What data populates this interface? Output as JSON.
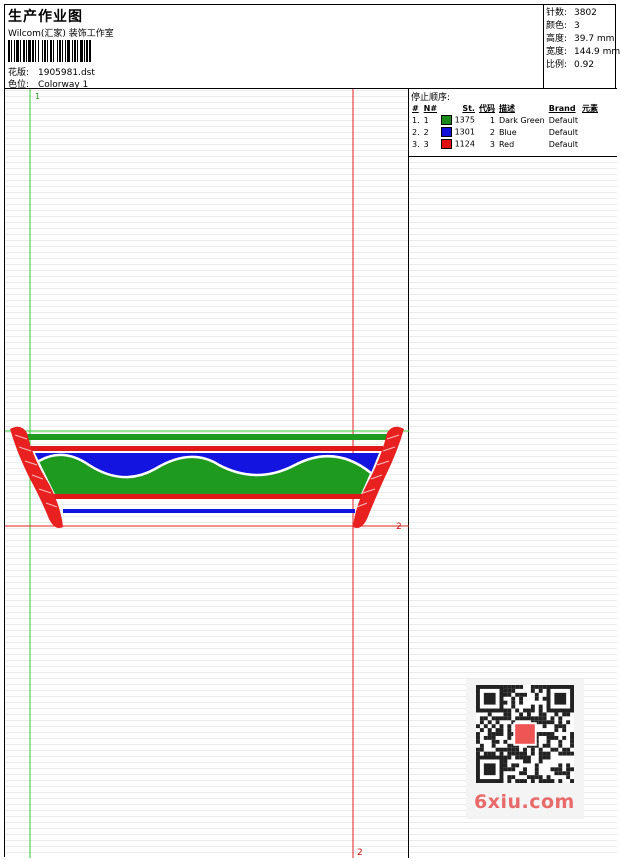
{
  "header": {
    "title": "生产作业图",
    "studio": "Wilcom(汇家) 装饰工作室",
    "design_label": "花版:",
    "design_value": "1905981.dst",
    "colorway_label": "色位:",
    "colorway_value": "Colorway 1"
  },
  "stats": {
    "stitches_label": "针数:",
    "stitches_value": "3802",
    "colors_label": "颜色:",
    "colors_value": "3",
    "height_label": "高度:",
    "height_value": "39.7 mm",
    "width_label": "宽度:",
    "width_value": "144.9 mm",
    "scale_label": "比例:",
    "scale_value": "0.92"
  },
  "canvas": {
    "marker_top": "1",
    "marker_right": "2",
    "marker_bottom": "2"
  },
  "stop_sequence": {
    "label": "停止顺序:",
    "headers": [
      "#",
      "N#",
      "St.",
      "代码",
      "描述",
      "Brand",
      "元素"
    ],
    "rows": [
      {
        "idx": "1.",
        "n": "1",
        "color": "#1a8a1a",
        "stitches": "1375",
        "code": "1",
        "desc": "Dark Green",
        "brand": "Default",
        "element": ""
      },
      {
        "idx": "2.",
        "n": "2",
        "color": "#1010d8",
        "stitches": "1301",
        "code": "2",
        "desc": "Blue",
        "brand": "Default",
        "element": ""
      },
      {
        "idx": "3.",
        "n": "3",
        "color": "#e01010",
        "stitches": "1124",
        "code": "3",
        "desc": "Red",
        "brand": "Default",
        "element": ""
      }
    ]
  },
  "watermark": {
    "site": "6xiu.com",
    "qr_badge": "汉哥图库"
  }
}
